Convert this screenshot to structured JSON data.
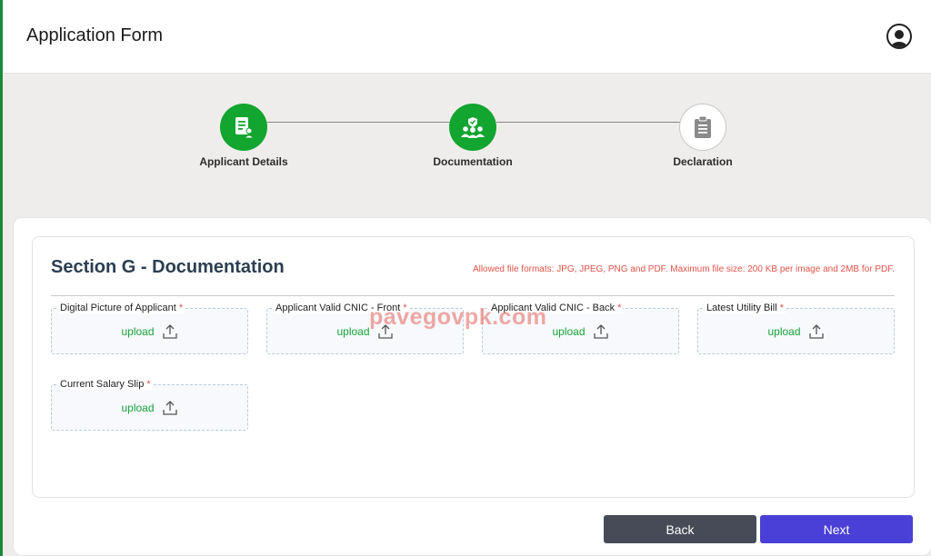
{
  "header": {
    "title": "Application Form",
    "profile_icon": "user-circle-icon"
  },
  "stepper": {
    "steps": [
      {
        "label": "Applicant Details",
        "status": "complete",
        "icon": "applicant-document-icon"
      },
      {
        "label": "Documentation",
        "status": "complete",
        "icon": "users-shield-icon"
      },
      {
        "label": "Declaration",
        "status": "pending",
        "icon": "clipboard-icon"
      }
    ],
    "active_color": "#12a52f"
  },
  "section": {
    "title": "Section G - Documentation",
    "allowed_note": "Allowed file formats: JPG, JPEG, PNG and PDF. Maximum file size: 200 KB per image and 2MB for PDF.",
    "fields": [
      {
        "label": "Digital Picture of Applicant",
        "required": "*",
        "action": "upload"
      },
      {
        "label": "Applicant Valid CNIC - Front",
        "required": "*",
        "action": "upload"
      },
      {
        "label": "Applicant Valid CNIC - Back",
        "required": "*",
        "action": "upload"
      },
      {
        "label": "Latest Utility Bill",
        "required": "*",
        "action": "upload"
      },
      {
        "label": "Current Salary Slip",
        "required": "*",
        "action": "upload"
      }
    ]
  },
  "watermark": "pavegovpk.com",
  "buttons": {
    "back": "Back",
    "next": "Next"
  },
  "colors": {
    "upload_text": "#17a33a",
    "required": "#e4534a",
    "back_btn": "#474a57",
    "next_btn": "#4a3fd6"
  }
}
